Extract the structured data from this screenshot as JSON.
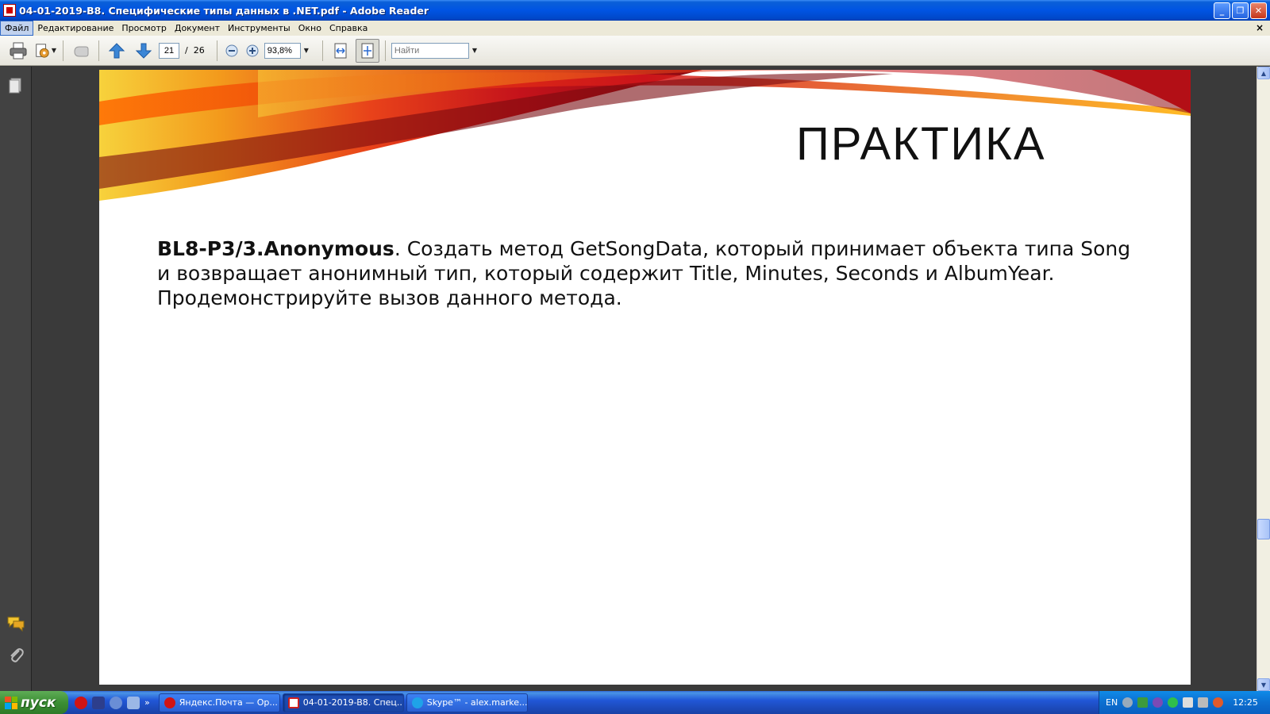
{
  "window": {
    "title": "04-01-2019-B8. Специфические типы данных в .NET.pdf - Adobe Reader",
    "minimize": "_",
    "restore": "❐",
    "close": "✕"
  },
  "menu": {
    "items": [
      "Файл",
      "Редактирование",
      "Просмотр",
      "Документ",
      "Инструменты",
      "Окно",
      "Справка"
    ],
    "doc_close": "×"
  },
  "toolbar": {
    "page_current": "21",
    "page_separator": "/",
    "page_total": "26",
    "zoom_value": "93,8%",
    "find_placeholder": "Найти"
  },
  "document": {
    "slide_title": "ПРАКТИКА",
    "task_id": "BL8-P3/3.Anonymous",
    "task_text": ". Создать метод GetSongData, который принимает объекта типа Song и возвращает анонимный тип, который содержит Title, Minutes, Seconds и AlbumYear. Продемонстрируйте вызов данного метода."
  },
  "taskbar": {
    "start_label": "пуск",
    "chevron": "»",
    "tasks": [
      {
        "label": "Яндекс.Почта — Ор...",
        "icon": "opera-icon",
        "color": "#d01414"
      },
      {
        "label": "04-01-2019-B8. Спец...",
        "icon": "pdf-icon",
        "color": "#cc2020"
      },
      {
        "label": "Skype™ - alex.marke...",
        "icon": "skype-icon",
        "color": "#1fa3e8"
      }
    ],
    "tray": {
      "lang": "EN",
      "clock": "12:25"
    }
  },
  "colors": {
    "title_bar": "#0054e3",
    "taskbar": "#245edb",
    "start_green": "#3c8f34",
    "doc_background": "#3a3a3a"
  }
}
